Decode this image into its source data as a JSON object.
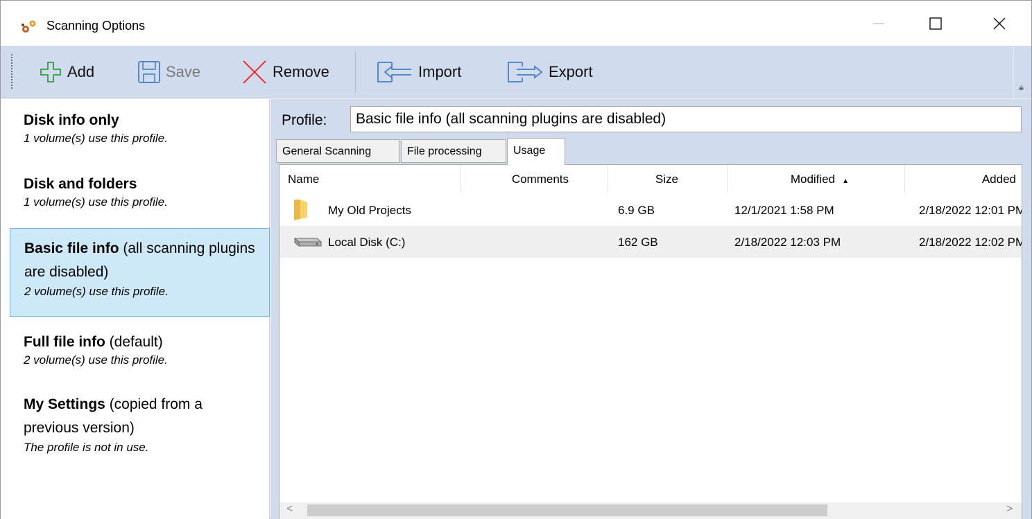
{
  "window": {
    "title": "Scanning Options",
    "controls": {
      "minimize": "—",
      "maximize": "☐",
      "close": "✕"
    }
  },
  "toolbar": {
    "add_label": "Add",
    "save_label": "Save",
    "remove_label": "Remove",
    "import_label": "Import",
    "export_label": "Export",
    "overflow_glyph": "⩧"
  },
  "profiles": [
    {
      "name": "Disk info only",
      "suffix": "",
      "usage": "1 volume(s) use this profile."
    },
    {
      "name": "Disk and folders",
      "suffix": "",
      "usage": "1 volume(s) use this profile."
    },
    {
      "name": "Basic file info",
      "suffix": " (all scanning plugins are disabled)",
      "usage": "2 volume(s) use this profile.",
      "selected": true
    },
    {
      "name": "Full file info",
      "suffix": " (default)",
      "usage": "2 volume(s) use this profile."
    },
    {
      "name": "My Settings",
      "suffix": " (copied from a previous version)",
      "usage": "The profile is not in use."
    }
  ],
  "editor": {
    "profile_label": "Profile:",
    "profile_value": "Basic file info (all scanning plugins are disabled)",
    "tabs": [
      "General Scanning",
      "File processing",
      "Usage"
    ],
    "active_tab": "Usage"
  },
  "usage_table": {
    "columns": [
      "Name",
      "Comments",
      "Size",
      "Modified",
      "Added"
    ],
    "sort_column": "Modified",
    "sort_glyph": "▲",
    "rows": [
      {
        "icon": "folder-icon",
        "name": "My Old Projects",
        "comments": "",
        "size": "6.9 GB",
        "modified": "12/1/2021 1:58 PM",
        "added": "2/18/2022 12:01 PM"
      },
      {
        "icon": "drive-icon",
        "name": "Local Disk (C:)",
        "comments": "",
        "size": "162 GB",
        "modified": "2/18/2022 12:03 PM",
        "added": "2/18/2022 12:02 PM"
      }
    ]
  },
  "scrollbar": {
    "left_arrow": "<",
    "right_arrow": ">"
  },
  "colors": {
    "toolbar_bg": "#d0dcee",
    "selection_bg": "#cde8f6",
    "selection_border": "#6fb3dc",
    "add_icon": "#2e9e3e",
    "remove_icon": "#e8302a",
    "io_icon": "#4a7fc0"
  }
}
